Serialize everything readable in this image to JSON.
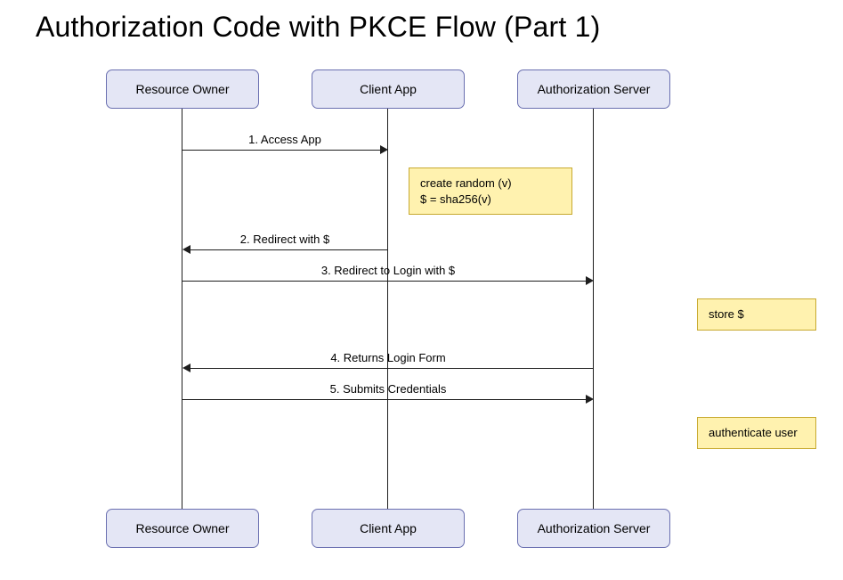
{
  "title": "Authorization Code with PKCE Flow (Part 1)",
  "actors": {
    "resource_owner": "Resource Owner",
    "client_app": "Client App",
    "auth_server": "Authorization Server"
  },
  "messages": {
    "m1": "1. Access App",
    "m2": "2. Redirect with $",
    "m3": "3. Redirect to Login with $",
    "m4": "4. Returns Login Form",
    "m5": "5. Submits Credentials"
  },
  "notes": {
    "n1": "create random (v)\n$ = sha256(v)",
    "n2": "store $",
    "n3": "authenticate user"
  }
}
